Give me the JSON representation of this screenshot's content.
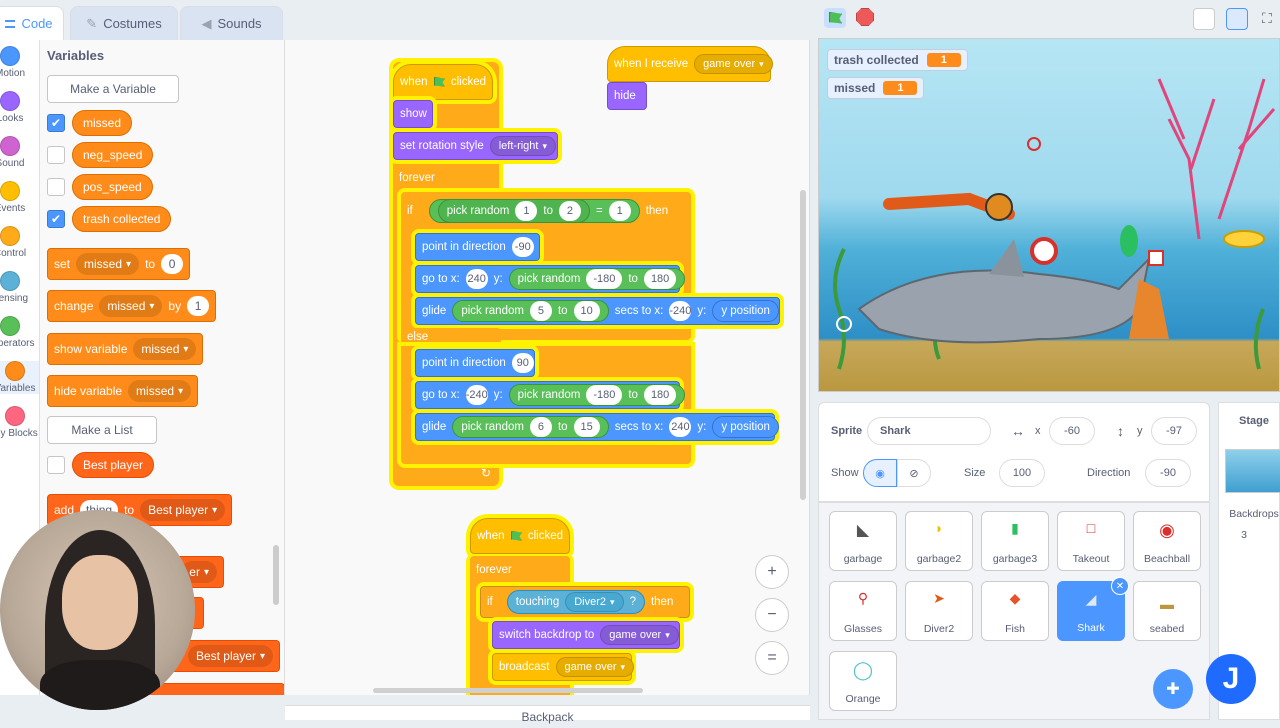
{
  "tabs": [
    {
      "label": "Code",
      "icon": "code-icon"
    },
    {
      "label": "Costumes",
      "icon": "brush-icon"
    },
    {
      "label": "Sounds",
      "icon": "speaker-icon"
    }
  ],
  "categories": [
    {
      "label": "Motion",
      "color": "#4c97ff"
    },
    {
      "label": "Looks",
      "color": "#9966ff"
    },
    {
      "label": "Sound",
      "color": "#cf63cf"
    },
    {
      "label": "Events",
      "color": "#ffbf00"
    },
    {
      "label": "Control",
      "color": "#ffab19"
    },
    {
      "label": "Sensing",
      "color": "#5cb1d6"
    },
    {
      "label": "Operators",
      "color": "#59c059"
    },
    {
      "label": "Variables",
      "color": "#ff8c1a"
    },
    {
      "label": "My Blocks",
      "color": "#ff6680"
    }
  ],
  "palette": {
    "title": "Variables",
    "make_variable": "Make a Variable",
    "variables": [
      {
        "name": "missed",
        "checked": true
      },
      {
        "name": "neg_speed",
        "checked": false
      },
      {
        "name": "pos_speed",
        "checked": false
      },
      {
        "name": "trash collected",
        "checked": true
      }
    ],
    "set_block": {
      "label": "set",
      "var": "missed",
      "to": "to",
      "value": "0"
    },
    "change_block": {
      "label": "change",
      "var": "missed",
      "by": "by",
      "value": "1"
    },
    "show_block": {
      "label": "show variable",
      "var": "missed"
    },
    "hide_block": {
      "label": "hide variable",
      "var": "missed"
    },
    "make_list": "Make a List",
    "list": {
      "name": "Best player",
      "checked": false
    },
    "add_block": {
      "label": "add",
      "value": "thing",
      "to": "to",
      "list": "Best player"
    },
    "partial_list_1": "er",
    "partial_list_2": "Best player"
  },
  "scripts": {
    "script1": {
      "hat": "when",
      "hat_end": "clicked",
      "show": "show",
      "rotation": "set rotation style",
      "rotation_value": "left-right",
      "forever": "forever",
      "if": "if",
      "then": "then",
      "pick1": "pick random",
      "pick1_a": "1",
      "pick1_to": "to",
      "pick1_b": "2",
      "eq": "=",
      "eq_val": "1",
      "point": "point in direction",
      "dir1": "-90",
      "goto": "go to x:",
      "goto_x1": "240",
      "y_lbl": "y:",
      "pick2": "pick random",
      "pick2_a": "-180",
      "pick2_to": "to",
      "pick2_b": "180",
      "glide": "glide",
      "pick3": "pick random",
      "pick3_a": "5",
      "pick3_to": "to",
      "pick3_b": "10",
      "secs": "secs to x:",
      "glide_x1": "-240",
      "ypos": "y position",
      "else": "else",
      "dir2": "90",
      "goto_x2": "-240",
      "pick4_a": "-180",
      "pick4_b": "180",
      "pick5_a": "6",
      "pick5_b": "15",
      "glide_x2": "240"
    },
    "script2": {
      "hat": "when I receive",
      "msg": "game over",
      "hide": "hide"
    },
    "script3": {
      "hat": "when",
      "hat_end": "clicked",
      "forever": "forever",
      "if": "if",
      "touching": "touching",
      "target": "Diver2",
      "q": "?",
      "then": "then",
      "switch": "switch backdrop to",
      "backdrop": "game over",
      "broadcast": "broadcast",
      "message": "game over"
    },
    "zoom_in": "+",
    "zoom_out": "−",
    "zoom_reset": "="
  },
  "backpack": "Backpack",
  "stage": {
    "monitors": [
      {
        "label": "trash collected",
        "value": "1"
      },
      {
        "label": "missed",
        "value": "1"
      }
    ]
  },
  "sprite_info": {
    "sprite_label": "Sprite",
    "sprite_name": "Shark",
    "x_label": "x",
    "x": "-60",
    "y_label": "y",
    "y": "-97",
    "show_label": "Show",
    "size_label": "Size",
    "size": "100",
    "direction_label": "Direction",
    "direction": "-90"
  },
  "sprites": [
    {
      "name": "garbage",
      "selected": false
    },
    {
      "name": "garbage2",
      "selected": false
    },
    {
      "name": "garbage3",
      "selected": false
    },
    {
      "name": "Takeout",
      "selected": false
    },
    {
      "name": "Beachball",
      "selected": false
    },
    {
      "name": "Glasses",
      "selected": false
    },
    {
      "name": "Diver2",
      "selected": false
    },
    {
      "name": "Fish",
      "selected": false
    },
    {
      "name": "Shark",
      "selected": true
    },
    {
      "name": "seabed",
      "selected": false
    },
    {
      "name": "Orange",
      "selected": false
    }
  ],
  "stage_panel": {
    "title": "Stage",
    "backdrops_label": "Backdrops",
    "backdrops_count": "3"
  }
}
